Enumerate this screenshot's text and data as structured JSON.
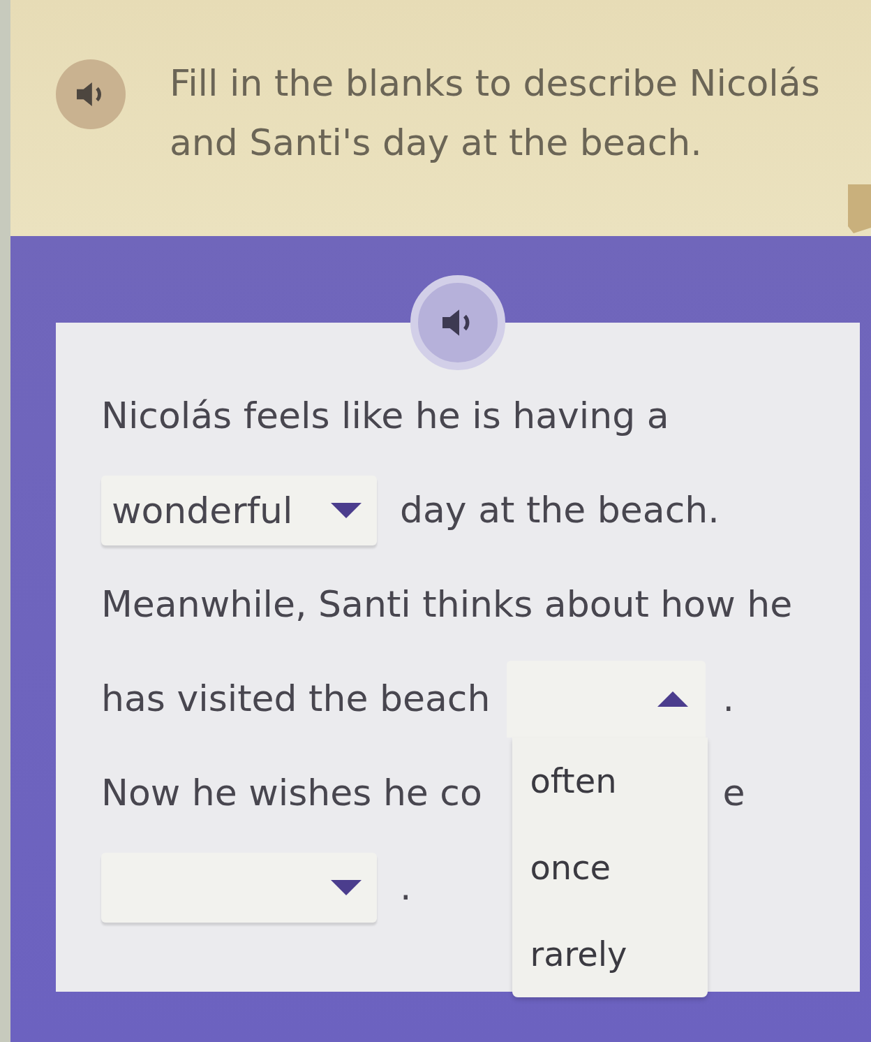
{
  "instruction": {
    "text": "Fill in the blanks to describe Nicolás and Santi's day at the beach."
  },
  "passage": {
    "rows": [
      {
        "segments": [
          {
            "kind": "text",
            "text": "Nicolás feels like he is having a"
          }
        ]
      },
      {
        "segments": [
          {
            "kind": "blank",
            "value": "wonderful",
            "expanded": false
          },
          {
            "kind": "text",
            "text": "day at the beach."
          }
        ]
      },
      {
        "segments": [
          {
            "kind": "text",
            "text": "Meanwhile, Santi thinks about how he"
          }
        ]
      },
      {
        "segments": [
          {
            "kind": "text",
            "text": "has visited the beach"
          },
          {
            "kind": "blank",
            "expanded": true,
            "options": [
              {
                "label": "often",
                "selected": false
              },
              {
                "label": "once",
                "selected": false
              },
              {
                "label": "rarely",
                "selected": false
              }
            ]
          },
          {
            "kind": "text",
            "text": "."
          }
        ]
      },
      {
        "segments": [
          {
            "kind": "text",
            "text": "Now he wishes he co"
          },
          {
            "kind": "text",
            "text": "e"
          }
        ]
      },
      {
        "segments": [
          {
            "kind": "blank",
            "expanded": false
          },
          {
            "kind": "text",
            "text": "."
          }
        ]
      }
    ]
  }
}
